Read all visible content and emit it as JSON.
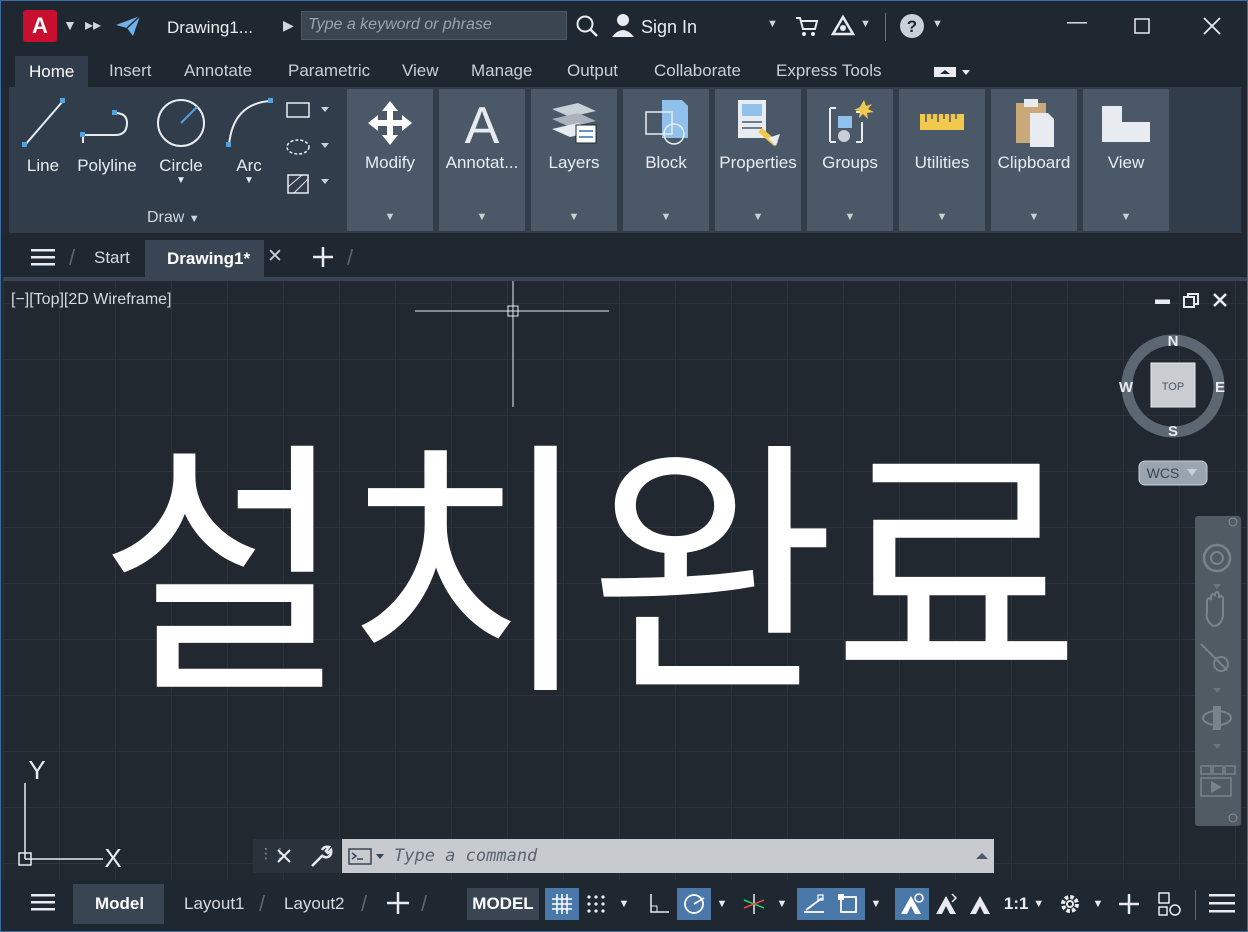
{
  "titlebar": {
    "app_logo": "A",
    "doc_title": "Drawing1...",
    "search_placeholder": "Type a keyword or phrase",
    "sign_in": "Sign In"
  },
  "ribbon_tabs": [
    "Home",
    "Insert",
    "Annotate",
    "Parametric",
    "View",
    "Manage",
    "Output",
    "Collaborate",
    "Express Tools"
  ],
  "draw_panel": {
    "title": "Draw",
    "tools": [
      "Line",
      "Polyline",
      "Circle",
      "Arc"
    ]
  },
  "panels": [
    "Modify",
    "Annotat...",
    "Layers",
    "Block",
    "Properties",
    "Groups",
    "Utilities",
    "Clipboard",
    "View"
  ],
  "file_tabs": {
    "start": "Start",
    "active": "Drawing1*"
  },
  "viewport": {
    "label": "[−][Top][2D Wireframe]",
    "canvas_text": "설치완료",
    "viewcube": {
      "n": "N",
      "s": "S",
      "e": "E",
      "w": "W",
      "face": "TOP",
      "wcs": "WCS"
    },
    "ucs": {
      "x": "X",
      "y": "Y"
    }
  },
  "command": {
    "placeholder": "Type a command"
  },
  "statusbar": {
    "tabs": [
      "Model",
      "Layout1",
      "Layout2"
    ],
    "model_btn": "MODEL",
    "scale": "1:1"
  },
  "colors": {
    "accent": "#4a78a8",
    "logo": "#c8102e",
    "ribbon_bg": "#323d4b",
    "panel_bg": "#4a5868"
  }
}
